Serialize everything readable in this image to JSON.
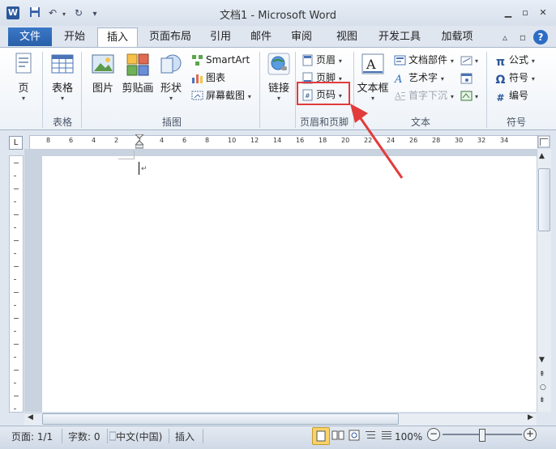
{
  "window": {
    "title": "文档1 - Microsoft Word",
    "app_icon": "W",
    "quick_access": [
      "save-icon",
      "undo-icon",
      "redo-icon",
      "customize-icon"
    ]
  },
  "tabs": {
    "file": "文件",
    "items": [
      "开始",
      "插入",
      "页面布局",
      "引用",
      "邮件",
      "审阅",
      "视图",
      "开发工具",
      "加载项"
    ],
    "active": "插入"
  },
  "ribbon": {
    "page_group": {
      "btn": "页"
    },
    "tables_group": {
      "btn": "表格",
      "label": "表格"
    },
    "illustrations": {
      "label": "插图",
      "picture": "图片",
      "clipart": "剪贴画",
      "shapes": "形状",
      "smartart": "SmartArt",
      "chart": "图表",
      "screenshot": "屏幕截图"
    },
    "links": {
      "btn": "链接"
    },
    "header_footer": {
      "label": "页眉和页脚",
      "header": "页眉",
      "footer": "页脚",
      "page_number": "页码"
    },
    "text": {
      "label": "文本",
      "textbox": "文本框",
      "quickparts": "文档部件",
      "wordart": "艺术字",
      "dropcap": "首字下沉"
    },
    "symbols": {
      "label": "符号",
      "equation": "公式",
      "symbol": "符号",
      "number": "编号"
    }
  },
  "ruler": {
    "numbers": [
      "8",
      "6",
      "4",
      "2",
      "2",
      "4",
      "6",
      "8",
      "10",
      "12",
      "14",
      "16",
      "18",
      "20",
      "22",
      "24",
      "26",
      "28",
      "30",
      "32",
      "34"
    ]
  },
  "statusbar": {
    "page": "页面: 1/1",
    "words": "字数: 0",
    "language": "中文(中国)",
    "mode": "插入",
    "zoom": "100%"
  },
  "colors": {
    "accent": "#2b579a",
    "highlight": "#e23b3b"
  }
}
